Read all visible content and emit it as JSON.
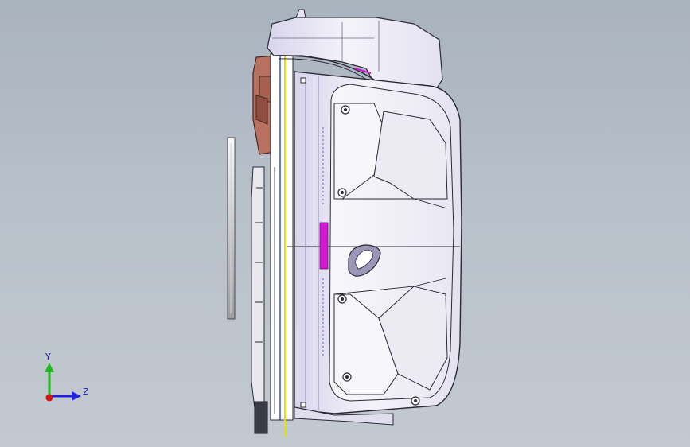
{
  "viewport": {
    "background_top": "#a9b3be",
    "background_bottom": "#c3c9d0"
  },
  "colors": {
    "shell": "#f1f0f7",
    "shell_shade": "#d9d7ea",
    "edge": "#2a2a36",
    "bracket": "#b87060",
    "accent_magenta": "#d319d3",
    "accent_yellow": "#e5e000",
    "accent_blue": "#2b3fd0",
    "axis_x": "#d11414",
    "axis_y": "#1fb81f",
    "axis_z": "#2222dd"
  },
  "triad": {
    "y_label": "Y",
    "z_label": "Z"
  }
}
